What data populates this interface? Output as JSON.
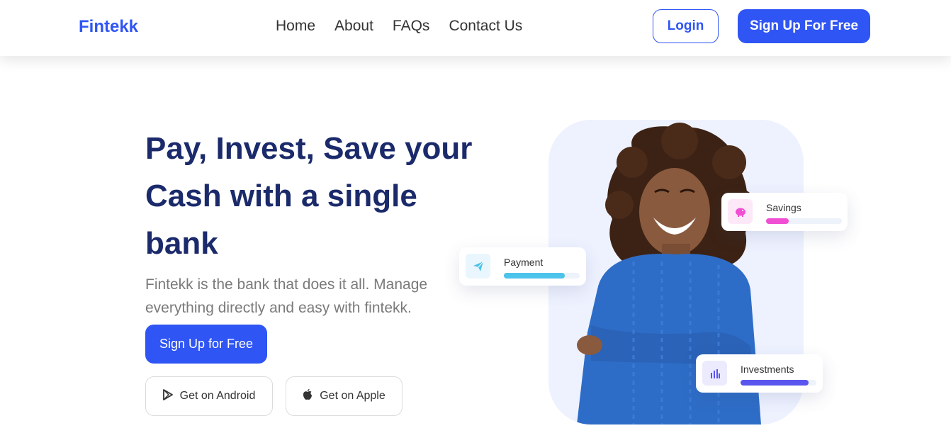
{
  "brand": {
    "name": "Fintekk",
    "color": "#2f55f4"
  },
  "nav": {
    "items": [
      "Home",
      "About",
      "FAQs",
      "Contact Us"
    ]
  },
  "header": {
    "login_label": "Login",
    "signup_label": "Sign Up For Free"
  },
  "hero": {
    "title": "Pay, Invest, Save your Cash with a single bank",
    "subtitle": "Fintekk is the bank that does it all. Manage everything directly and easy with fintekk.",
    "cta_label": "Sign Up for Free",
    "android_label": "Get on Android",
    "apple_label": "Get on Apple"
  },
  "cards": {
    "payment": {
      "label": "Payment",
      "icon": "send-icon",
      "progress": 0.8,
      "color": "#4cc3ea"
    },
    "savings": {
      "label": "Savings",
      "icon": "piggy-bank-icon",
      "progress": 0.3,
      "color": "#f04fd3"
    },
    "investments": {
      "label": "Investments",
      "icon": "bar-chart-icon",
      "progress": 0.9,
      "color": "#5a55ee"
    }
  }
}
